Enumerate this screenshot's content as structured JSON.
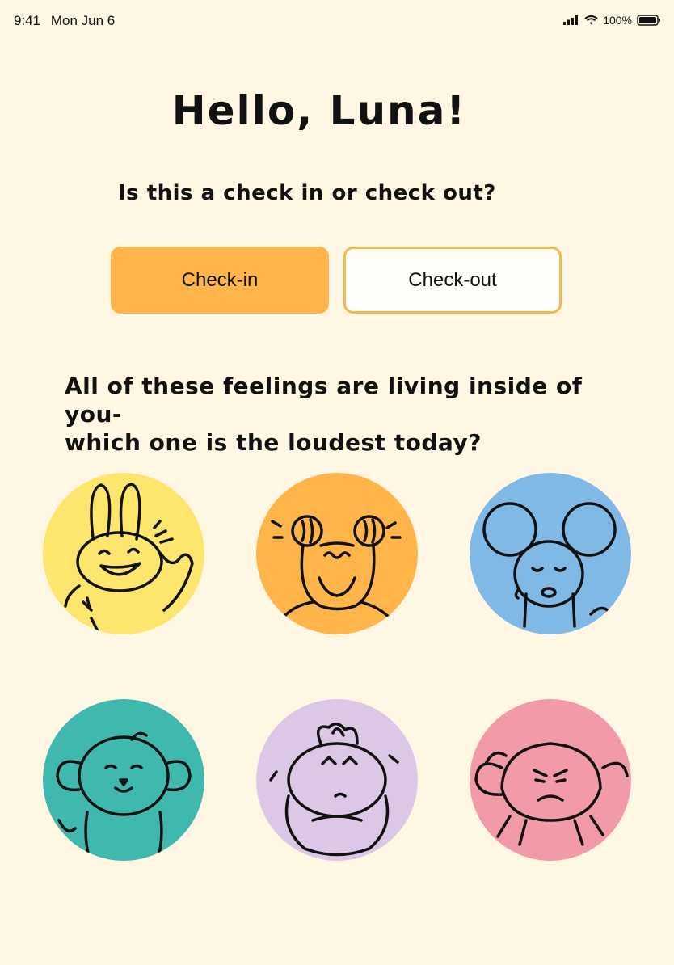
{
  "status_bar": {
    "time": "9:41",
    "date": "Mon Jun 6",
    "battery": "100%"
  },
  "header": {
    "title": "Hello, Luna!"
  },
  "check": {
    "question": "Is this a check in or check out?",
    "checkin_label": "Check-in",
    "checkout_label": "Check-out",
    "selected": "checkin"
  },
  "feelings_prompt": {
    "line1": "All of these feelings are living inside of you-",
    "line2": "which one is the loudest today?"
  },
  "feelings": [
    {
      "icon": "happy-bunny-icon",
      "color": "#fde66d"
    },
    {
      "icon": "anxious-frog-icon",
      "color": "#ffb54a"
    },
    {
      "icon": "sad-mouse-icon",
      "color": "#80b9e6"
    },
    {
      "icon": "calm-puppy-icon",
      "color": "#3fb8ad"
    },
    {
      "icon": "worried-creature-icon",
      "color": "#dcc8e6"
    },
    {
      "icon": "angry-crab-icon",
      "color": "#f29aa8"
    }
  ]
}
